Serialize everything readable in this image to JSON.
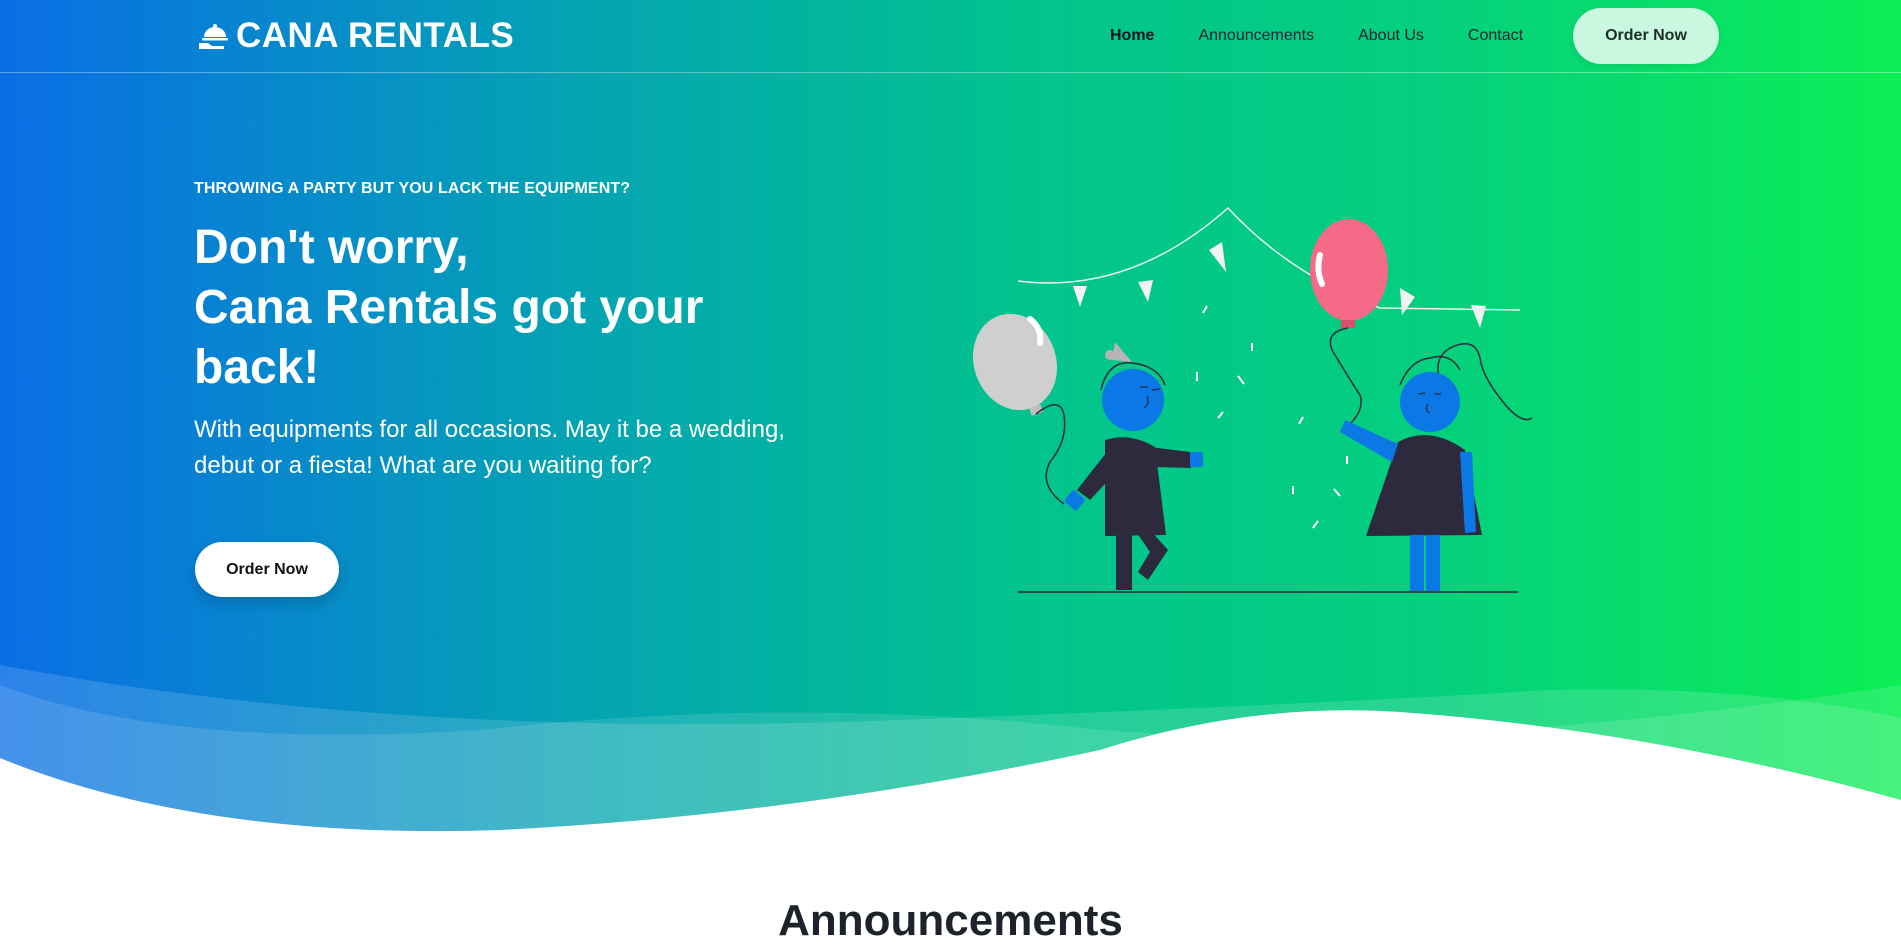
{
  "brand": {
    "name": "CANA RENTALS",
    "icon": "cloche-serving-icon"
  },
  "nav": {
    "items": [
      {
        "label": "Home",
        "active": true
      },
      {
        "label": "Announcements",
        "active": false
      },
      {
        "label": "About Us",
        "active": false
      },
      {
        "label": "Contact",
        "active": false
      }
    ],
    "cta": "Order Now"
  },
  "hero": {
    "eyebrow": "THROWING A PARTY BUT YOU LACK THE EQUIPMENT?",
    "headline": [
      "Don't worry,",
      "Cana Rentals got your",
      "back!"
    ],
    "lead": [
      "With equipments for all occasions. May it be a wedding,",
      "debut or a fiesta! What are you waiting for?"
    ],
    "cta": "Order Now",
    "illustration": "party-balloons-illustration"
  },
  "sections": {
    "announcements_title": "Announcements"
  },
  "colors": {
    "gradient_start": "#0a6ee6",
    "gradient_mid": "#02c48c",
    "gradient_end": "#0cee55",
    "nav_cta_bg": "#c9f7e0",
    "character_blue": "#0b78e6",
    "character_dark": "#2d2a3d",
    "balloon_pink": "#f56a86",
    "balloon_gray": "#cfcfcf"
  }
}
